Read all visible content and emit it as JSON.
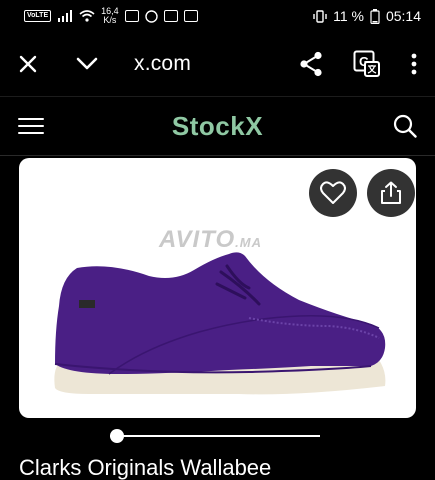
{
  "status_bar": {
    "volte": "VoLTE",
    "speed_value": "16,4",
    "speed_unit": "K/s",
    "battery_pct": "11 %",
    "time": "05:14"
  },
  "browser": {
    "url": "x.com",
    "icons": [
      "close-icon",
      "chevron-down-icon",
      "share-icon",
      "translate-icon",
      "more-vert-icon"
    ]
  },
  "site_header": {
    "logo": "StockX",
    "logo_color": "#8fc8a3"
  },
  "product": {
    "watermark": "AVITO",
    "watermark_suffix": ".MA",
    "title": "Clarks Originals Wallabee",
    "shoe_color": "#4a1f85",
    "sole_color": "#ede6d6",
    "image_slider_position": 0.0
  }
}
